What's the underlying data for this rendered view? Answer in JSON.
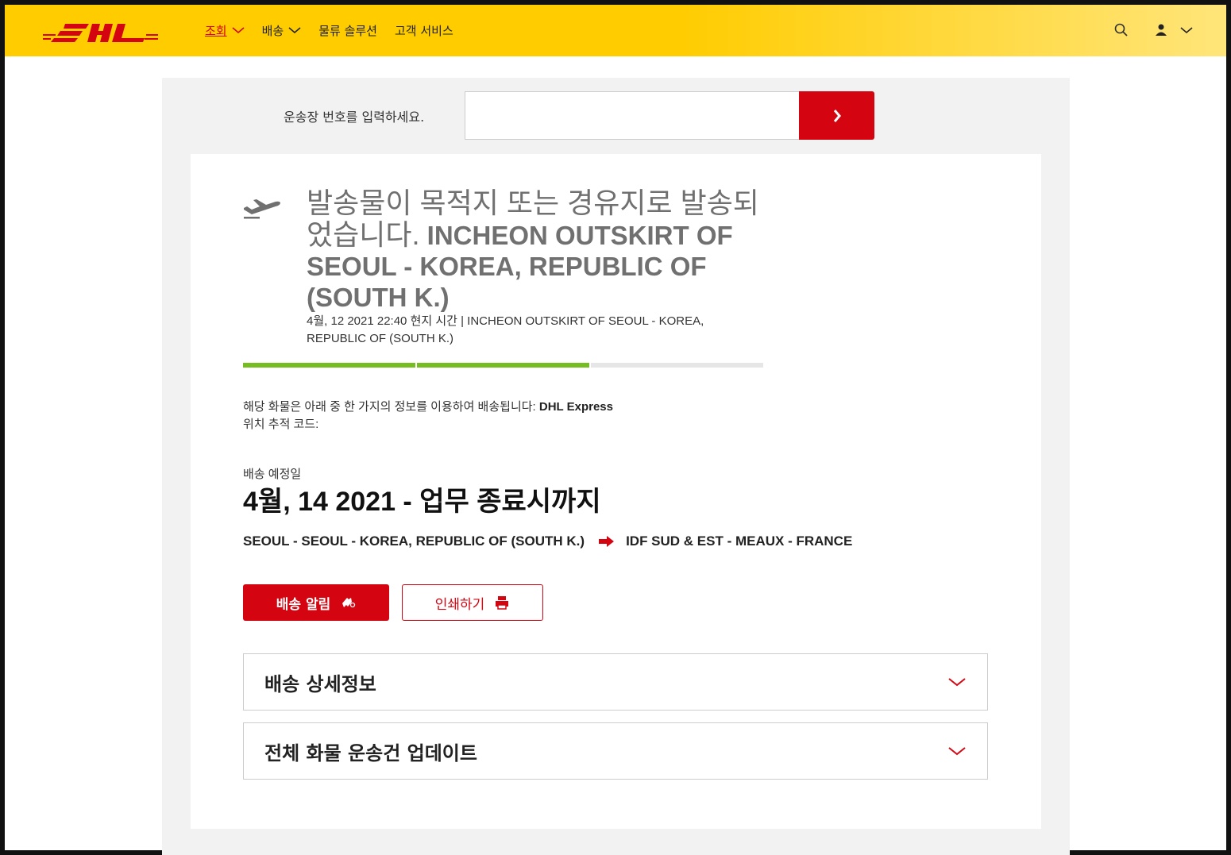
{
  "header": {
    "brand": "DHL",
    "nav": [
      {
        "label": "조회",
        "active": true,
        "has_menu": true
      },
      {
        "label": "배송",
        "active": false,
        "has_menu": true
      },
      {
        "label": "물류 솔루션",
        "active": false,
        "has_menu": false
      },
      {
        "label": "고객 서비스",
        "active": false,
        "has_menu": false
      }
    ],
    "icons": [
      "search-icon",
      "user-icon",
      "chevron-down-icon"
    ]
  },
  "search": {
    "label": "운송장 번호를 입력하세요.",
    "value": "",
    "submit_icon": "chevron-right-icon"
  },
  "status": {
    "icon": "plane-icon",
    "title_ko": "발송물이 목적지 또는 경유지로 발송되었습니다.",
    "title_location": " INCHEON OUTSKIRT OF SEOUL - KOREA, REPUBLIC OF (SOUTH K.)",
    "subtitle": "4월, 12 2021 22:40 현지 시간 | INCHEON OUTSKIRT OF SEOUL - KOREA, REPUBLIC OF (SOUTH K.)",
    "progress_steps_total": 3,
    "progress_steps_done": 2
  },
  "info": {
    "line1_prefix": "해당 화물은 아래 중 한 가지의 정보를 이용하여 배송됩니다: ",
    "line1_service": "DHL Express",
    "line2": "위치 추적 코드:"
  },
  "eta": {
    "label": "배송 예정일",
    "value": "4월, 14 2021 - 업무 종료시까지"
  },
  "route": {
    "origin": "SEOUL - SEOUL - KOREA, REPUBLIC OF (SOUTH K.)",
    "destination": "IDF SUD & EST - MEAUX - FRANCE"
  },
  "actions": {
    "notify_label": "배송 알림",
    "print_label": "인쇄하기"
  },
  "accordions": [
    {
      "title": "배송 상세정보"
    },
    {
      "title": "전체 화물 운송건 업데이트"
    }
  ],
  "colors": {
    "dhl_yellow": "#ffcc00",
    "dhl_red": "#d40511",
    "progress_green": "#76bd22"
  }
}
